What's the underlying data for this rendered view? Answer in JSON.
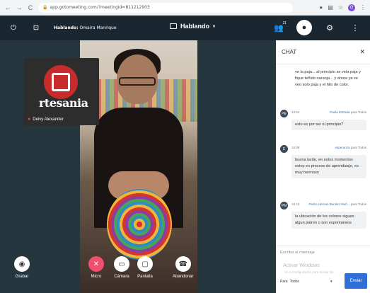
{
  "browser": {
    "url": "app.gotomeeting.com/?meetingId=811212903"
  },
  "app_bar": {
    "speaking_prefix": "Hablando:",
    "speaking_name": "Omaira Manrique",
    "center_title": "Hablando",
    "participant_count": "21"
  },
  "tile": {
    "logo_text": "rtesania",
    "name": "Deivy Alexander"
  },
  "controls": {
    "record": "Grabar",
    "mic": "Micro",
    "camera": "Cámara",
    "screen": "Pantalla",
    "leave": "Abandonar"
  },
  "chat": {
    "title": "CHAT",
    "messages": [
      {
        "avatar": "",
        "time": "",
        "sender": "",
        "to": "",
        "text": "ve la paja... al principio se veía paja y fique teñido naranja... y ahora ya se veo solo paja y el hilo de color."
      },
      {
        "avatar": "PE",
        "time": "13:54",
        "sender": "Paola Estrada",
        "to": "para Todos",
        "text": "esto es por ser el principio?"
      },
      {
        "avatar": "E",
        "time": "14:09",
        "sender": "esperanza",
        "to": "para Todos",
        "text": "buena tarde, en estos momentos estoy en proceso de aprendizaje, es muy hermoso"
      },
      {
        "avatar": "PM",
        "time": "14:13",
        "sender": "Pedro Hernan Benitez Muñ...",
        "to": "para Todos",
        "text": "la ubicación de los colores siguen algun patron o son espontaneos"
      }
    ],
    "input_placeholder": "Escriba el mensaje",
    "watermark": "Activar Windows",
    "watermark_sub": "Ve a Configuración para activar Wi...",
    "to_label": "Para",
    "to_value": "Todos",
    "send": "Enviar"
  }
}
